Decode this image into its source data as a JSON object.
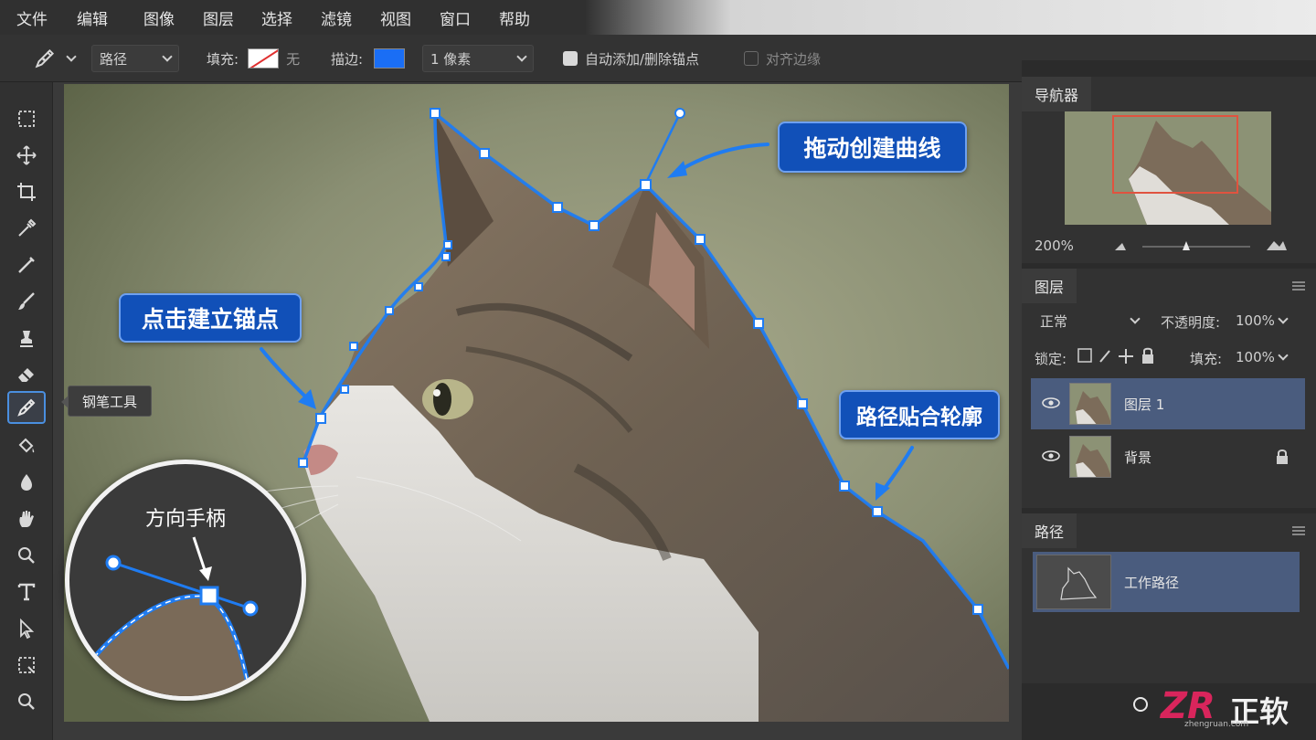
{
  "menu": [
    "文件",
    "编辑",
    "图像",
    "图层",
    "选择",
    "滤镜",
    "视图",
    "窗口",
    "帮助"
  ],
  "options": {
    "tool_mode": "路径",
    "fill_label": "填充:",
    "fill_value": "无",
    "stroke_label": "描边:",
    "stroke_color": "#1a6ef5",
    "stroke_width": "1 像素",
    "auto_add_delete": "自动添加/删除锚点",
    "auto_add_delete_checked": true,
    "align_edges": "对齐边缘",
    "align_edges_checked": false
  },
  "tooltip": "钢笔工具",
  "callouts": {
    "drag_curve": "拖动创建曲线",
    "click_anchor": "点击建立锚点",
    "path_fit": "路径贴合轮廓",
    "direction_handle": "方向手柄"
  },
  "navigator": {
    "title": "导航器",
    "zoom": "200%"
  },
  "layers": {
    "title": "图层",
    "blend_mode": "正常",
    "opacity_label": "不透明度:",
    "opacity": "100%",
    "lock_label": "锁定:",
    "fill_label": "填充:",
    "fill": "100%",
    "items": [
      {
        "name": "图层 1",
        "selected": true,
        "locked": false
      },
      {
        "name": "背景",
        "selected": false,
        "locked": true
      }
    ]
  },
  "paths": {
    "title": "路径",
    "items": [
      {
        "name": "工作路径",
        "selected": true
      }
    ]
  },
  "watermark": {
    "logo": "ZR",
    "brand": "正软",
    "domain": "zhengruan.com"
  },
  "colors": {
    "accent": "#1a6ef5",
    "callout_bg": "#1150b8",
    "selected_row": "#4a5c7e"
  }
}
